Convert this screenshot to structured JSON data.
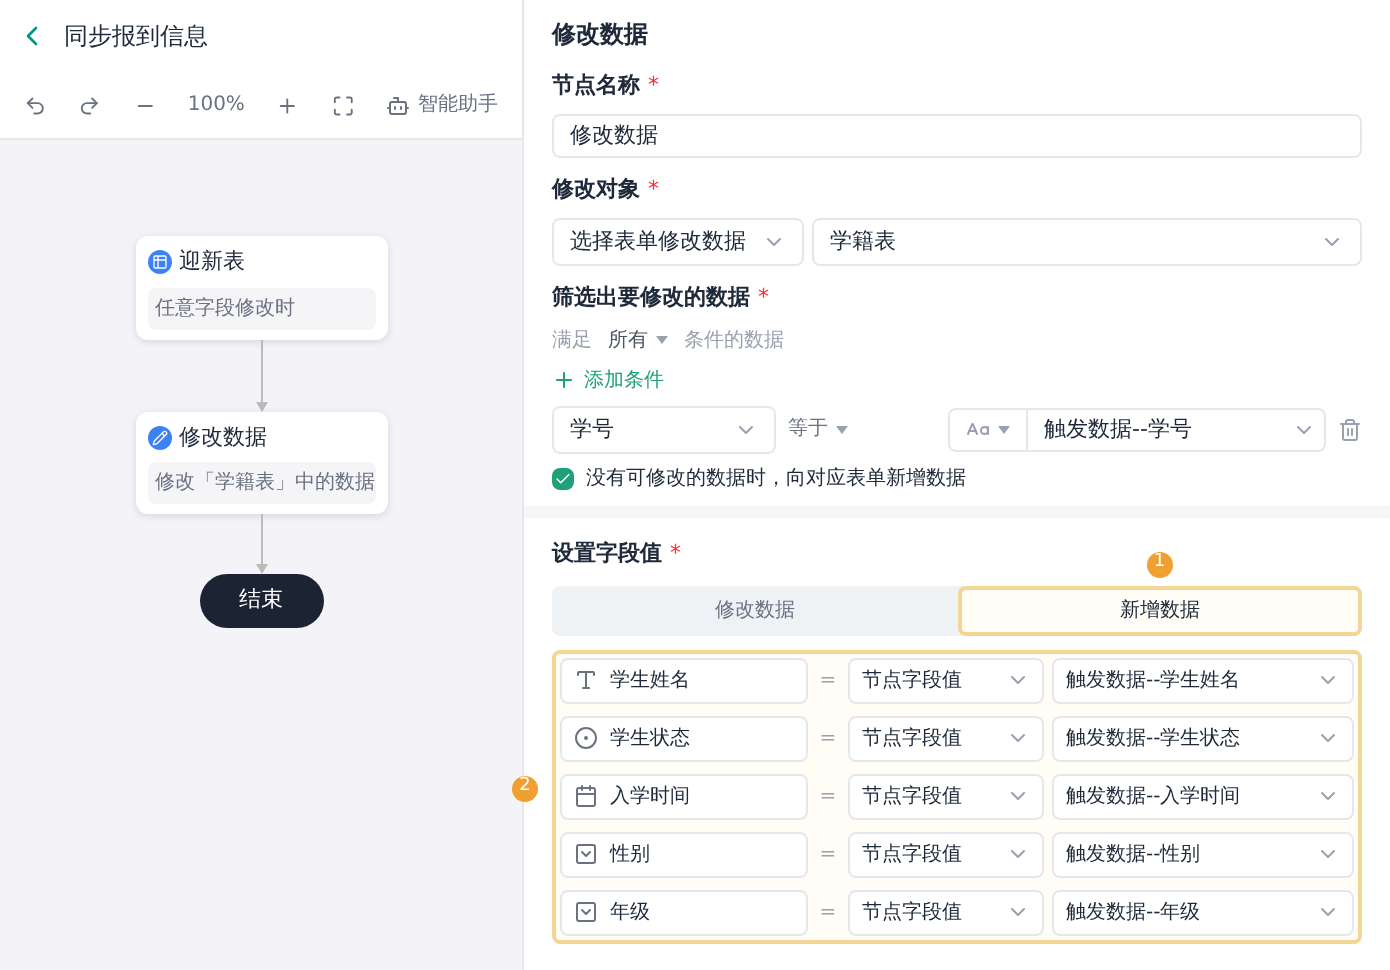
{
  "header": {
    "title": "同步报到信息"
  },
  "toolbar": {
    "zoom": "100%",
    "assistant": "智能助手"
  },
  "flow": {
    "nodes": [
      {
        "kind": "trigger",
        "title": "迎新表",
        "subtitle": "任意字段修改时"
      },
      {
        "kind": "action",
        "title": "修改数据",
        "subtitle": "修改「学籍表」中的数据"
      },
      {
        "kind": "end",
        "title": "结束"
      }
    ]
  },
  "panel": {
    "title": "修改数据",
    "node_name": {
      "label": "节点名称",
      "required": "*",
      "value": "修改数据"
    },
    "target": {
      "label": "修改对象",
      "required": "*",
      "mode": "选择表单修改数据",
      "table": "学籍表"
    },
    "filter": {
      "label": "筛选出要修改的数据",
      "required": "*",
      "prefix": "满足",
      "match": "所有",
      "suffix": "条件的数据",
      "add": "添加条件",
      "condition": {
        "field": "学号",
        "operator": "等于",
        "value": "触发数据--学号"
      },
      "insert_if_missing": {
        "label": "没有可修改的数据时，向对应表单新增数据",
        "checked": true
      }
    },
    "fields": {
      "label": "设置字段值",
      "required": "*",
      "tabs": [
        {
          "label": "修改数据",
          "selected": false
        },
        {
          "label": "新增数据",
          "selected": true,
          "badge": "1"
        }
      ],
      "rows_badge": "2",
      "rows": [
        {
          "kind": "text",
          "name": "学生姓名",
          "eq": "=",
          "source": "节点字段值",
          "value": "触发数据--学生姓名"
        },
        {
          "kind": "radio",
          "name": "学生状态",
          "eq": "=",
          "source": "节点字段值",
          "value": "触发数据--学生状态"
        },
        {
          "kind": "date",
          "name": "入学时间",
          "eq": "=",
          "source": "节点字段值",
          "value": "触发数据--入学时间"
        },
        {
          "kind": "select",
          "name": "性别",
          "eq": "=",
          "source": "节点字段值",
          "value": "触发数据--性别"
        },
        {
          "kind": "select",
          "name": "年级",
          "eq": "=",
          "source": "节点字段值",
          "value": "触发数据--年级"
        }
      ]
    }
  }
}
